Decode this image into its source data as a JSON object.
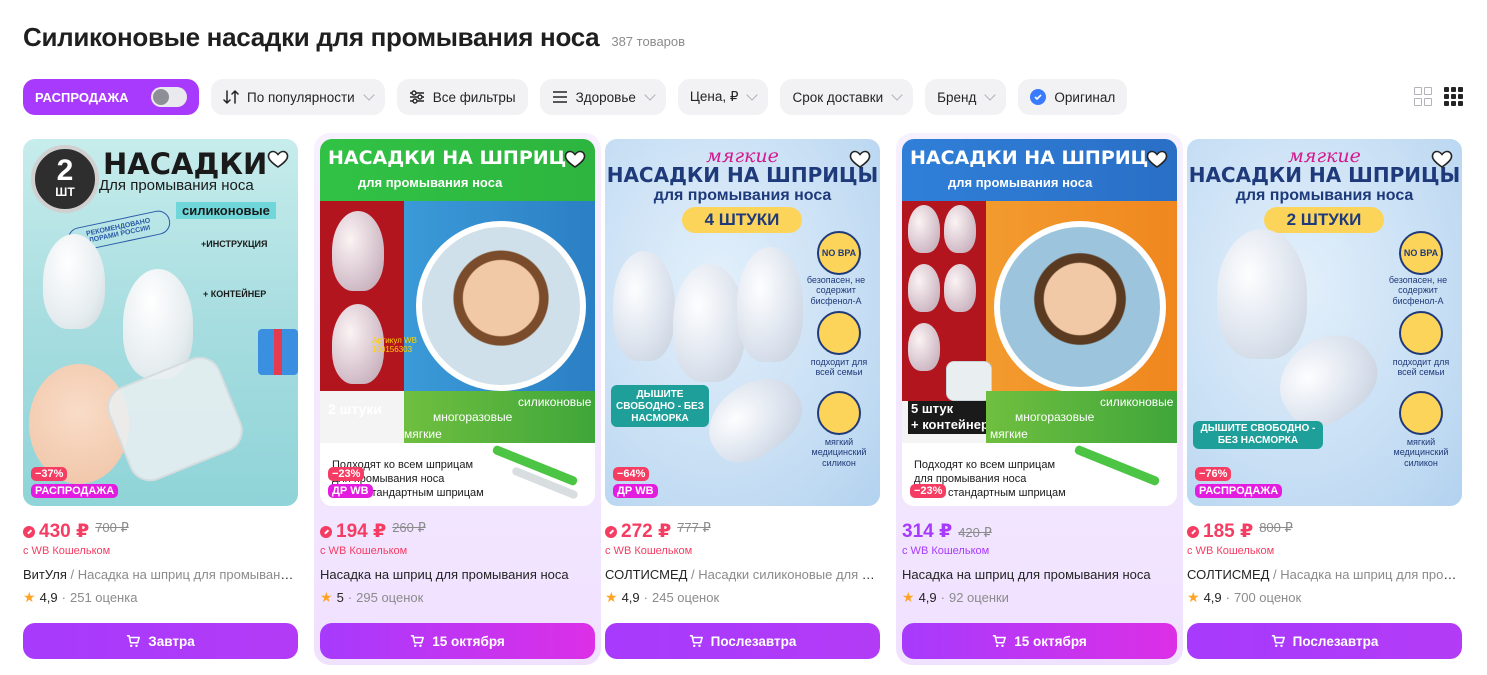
{
  "header": {
    "title": "Силиконовые насадки для промывания носа",
    "count": "387 товаров"
  },
  "filters": {
    "sale_label": "РАСПРОДАЖА",
    "sort_label": "По популярности",
    "all_filters_label": "Все фильтры",
    "category_label": "Здоровье",
    "price_label": "Цена, ₽",
    "delivery_label": "Срок доставки",
    "brand_label": "Бренд",
    "original_label": "Оригинал"
  },
  "colors": {
    "accent": "#a73afd",
    "price_red": "#f53c62",
    "promo_pink": "#e31ce0"
  },
  "products": [
    {
      "discount": "−37%",
      "promo": "РАСПРОДАЖА",
      "price": "430 ₽",
      "old_price": "700 ₽",
      "wallet": "с WB Кошельком",
      "brand": "ВитУля",
      "title": "Насадка на шприц для промывания носа",
      "rating": "4,9",
      "reviews": "251 оценка",
      "delivery": "Завтра",
      "art": {
        "big": "НАСАДКИ",
        "sub": "Для промывания носа",
        "tag": "силиконовые",
        "count": "2",
        "unit": "ШТ",
        "note1": "+ИНСТРУКЦИЯ",
        "note2": "+ КОНТЕЙНЕР",
        "stamp": "РЕКОМЕНДОВАНО ЛОРАМИ РОССИИ"
      }
    },
    {
      "discount": "−23%",
      "promo": "ДР WB",
      "price": "194 ₽",
      "old_price": "260 ₽",
      "wallet": "с WB Кошельком",
      "brand": "",
      "title": "Насадка на шприц для промывания носа",
      "rating": "5",
      "reviews": "295 оценок",
      "delivery": "15 октября",
      "art": {
        "big": "НАСАДКИ НА ШПРИЦ",
        "sub": "для промывания носа",
        "qty": "2 штуки",
        "l1": "силиконовые",
        "l2": "многоразовые",
        "l3": "мягкие",
        "b1": "Подходят ко всем шприцам",
        "b2": "для промывания носа",
        "b3": "стандартным шприцам",
        "art_no": "Артикул WB",
        "art_no2": "100156303"
      }
    },
    {
      "discount": "−64%",
      "promo": "ДР WB",
      "price": "272 ₽",
      "old_price": "777 ₽",
      "wallet": "с WB Кошельком",
      "brand": "СОЛТИСМЕД",
      "title": "Насадки силиконовые для промывания носа",
      "rating": "4,9",
      "reviews": "245 оценок",
      "delivery": "Послезавтра",
      "art": {
        "script": "мягкие",
        "big": "НАСАДКИ НА ШПРИЦЫ",
        "sub": "для промывания носа",
        "qty": "4 ШТУКИ",
        "f1": "безопасен, не содержит бисфенол-А",
        "f2": "подходит для всей семьи",
        "f3": "мягкий медицинский силикон",
        "breathe": "ДЫШИТЕ СВОБОДНО - БЕЗ НАСМОРКА",
        "bpa": "NO BPA"
      }
    },
    {
      "discount": "−23%",
      "promo": "",
      "price": "314 ₽",
      "old_price": "420 ₽",
      "wallet": "с WB Кошельком",
      "brand": "",
      "title": "Насадка на шприц для промывания носа",
      "rating": "4,9",
      "reviews": "92 оценки",
      "delivery": "15 октября",
      "art": {
        "big": "НАСАДКИ НА ШПРИЦ",
        "sub": "для промывания носа",
        "qty": "5 штук",
        "qty2": "+ контейнер",
        "l1": "силиконовые",
        "l2": "многоразовые",
        "l3": "мягкие",
        "b1": "Подходят ко всем шприцам",
        "b2": "для промывания носа",
        "b3": "стандартным шприцам"
      }
    },
    {
      "discount": "−76%",
      "promo": "РАСПРОДАЖА",
      "price": "185 ₽",
      "old_price": "800 ₽",
      "wallet": "с WB Кошельком",
      "brand": "СОЛТИСМЕД",
      "title": "Насадка на шприц для промывания носа",
      "rating": "4,9",
      "reviews": "700 оценок",
      "delivery": "Послезавтра",
      "art": {
        "script": "мягкие",
        "big": "НАСАДКИ НА ШПРИЦЫ",
        "sub": "для промывания носа",
        "qty": "2 ШТУКИ",
        "f1": "безопасен, не содержит бисфенол-А",
        "f2": "подходит для всей семьи",
        "f3": "мягкий медицинский силикон",
        "breathe": "ДЫШИТЕ СВОБОДНО - БЕЗ НАСМОРКА",
        "bpa": "NO BPA"
      }
    }
  ]
}
